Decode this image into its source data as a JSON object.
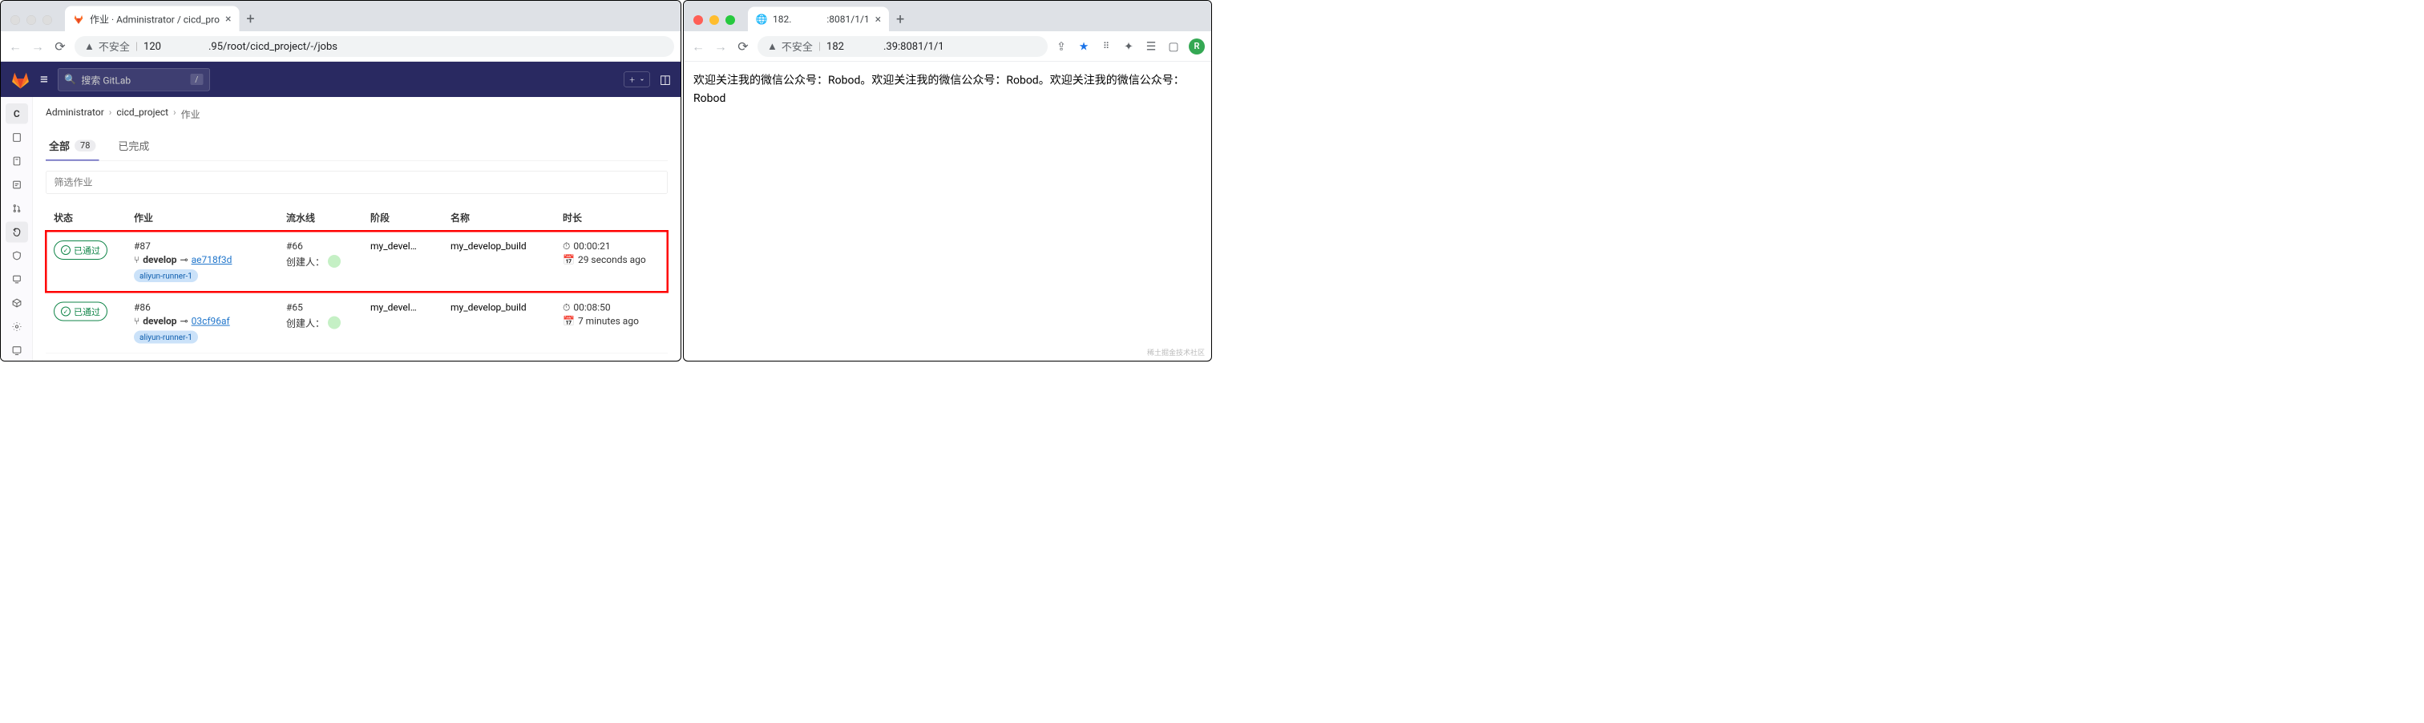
{
  "left_window": {
    "tab": {
      "title": "作业 · Administrator / cicd_pro",
      "favicon": "gitlab"
    },
    "address": {
      "warn_label": "不安全",
      "url_part1": "120",
      "url_part2": ".95/root/cicd_project/-/jobs"
    },
    "gitlab": {
      "search_placeholder": "搜索 GitLab",
      "search_kbd": "/",
      "sidebar_project_letter": "C",
      "breadcrumb": {
        "a": "Administrator",
        "b": "cicd_project",
        "c": "作业"
      },
      "tabs": {
        "all": "全部",
        "all_count": "78",
        "done": "已完成"
      },
      "filter_placeholder": "筛选作业",
      "columns": {
        "status": "状态",
        "job": "作业",
        "pipeline": "流水线",
        "stage": "阶段",
        "name": "名称",
        "duration": "时长"
      },
      "jobs": [
        {
          "status": "已通过",
          "id": "#87",
          "branch": "develop",
          "commit": "ae718f3d",
          "runner_tag": "aliyun-runner-1",
          "pipeline_id": "#66",
          "creator_label": "创建人：",
          "stage": "my_devel…",
          "name": "my_develop_build",
          "duration": "00:00:21",
          "ago": "29 seconds ago",
          "highlighted": true
        },
        {
          "status": "已通过",
          "id": "#86",
          "branch": "develop",
          "commit": "03cf96af",
          "runner_tag": "aliyun-runner-1",
          "pipeline_id": "#65",
          "creator_label": "创建人：",
          "stage": "my_devel…",
          "name": "my_develop_build",
          "duration": "00:08:50",
          "ago": "7 minutes ago",
          "highlighted": false
        }
      ]
    }
  },
  "right_window": {
    "tab": {
      "title_prefix": "182.",
      "title_suffix": ":8081/1/1"
    },
    "address": {
      "warn_label": "不安全",
      "url_prefix": "182",
      "url_suffix": ".39:8081/1/1"
    },
    "avatar_letter": "R",
    "body_text": "欢迎关注我的微信公众号：Robod。欢迎关注我的微信公众号：Robod。欢迎关注我的微信公众号：Robod",
    "watermark": "稀土掘金技术社区"
  }
}
